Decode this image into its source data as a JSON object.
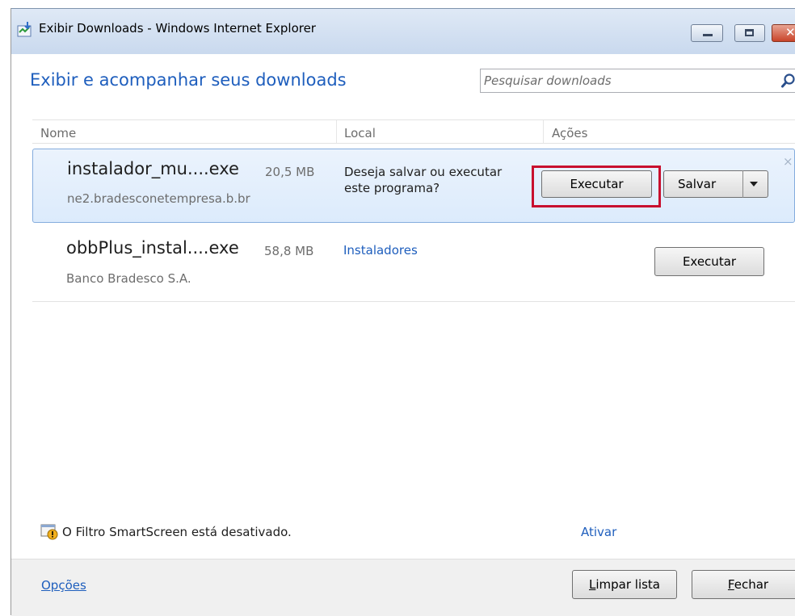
{
  "window": {
    "title": "Exibir Downloads - Windows Internet Explorer"
  },
  "header": {
    "title": "Exibir e acompanhar seus downloads",
    "search_placeholder": "Pesquisar downloads"
  },
  "columns": {
    "name": "Nome",
    "location": "Local",
    "actions": "Ações"
  },
  "downloads": [
    {
      "file_name": "instalador_mu....exe",
      "size": "20,5 MB",
      "source": "ne2.bradesconetempresa.b.br",
      "location_text_line1": "Deseja salvar ou executar",
      "location_text_line2": "este programa?",
      "run_label": "Executar",
      "save_label": "Salvar",
      "dismiss": "×"
    },
    {
      "file_name": "obbPlus_instal....exe",
      "size": "58,8 MB",
      "source": "Banco Bradesco S.A.",
      "location_link": "Instaladores",
      "run_label": "Executar"
    }
  ],
  "smartscreen": {
    "message": "O Filtro SmartScreen está desativado.",
    "enable_link": "Ativar"
  },
  "footer": {
    "options_link": "Opções",
    "clear_list_label": "Limpar lista",
    "close_label": "Fechar"
  },
  "colors": {
    "link_blue": "#1e5ebd",
    "highlight_red": "#c8102e",
    "selected_row_bg": "#dcebfc"
  }
}
